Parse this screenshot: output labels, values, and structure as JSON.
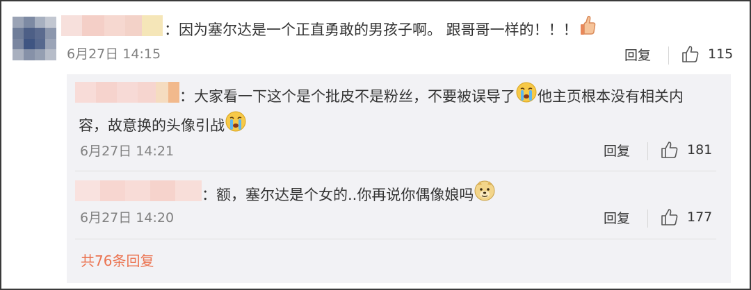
{
  "main_comment": {
    "text_part1": "：因为塞尔达是一个正直勇敢的男孩子啊。 跟哥哥一样的！！！",
    "time": "6月27日 14:15",
    "reply_label": "回复",
    "likes": "115",
    "emoji_icon": "thumbs-up-hand-icon"
  },
  "replies": [
    {
      "text_line1_a": "：大家看一下这个是个批皮不是粉丝，不要被误导了",
      "text_line1_b": "他主页根本没有相关内",
      "text_line2": "容，故意换的头像引战",
      "time": "6月27日 14:21",
      "reply_label": "回复",
      "likes": "181",
      "emoji_icon": "crying-face-icon"
    },
    {
      "text": "：额，塞尔达是个女的..你再说你偶像娘吗",
      "time": "6月27日 14:20",
      "reply_label": "回复",
      "likes": "177",
      "emoji_icon": "doge-icon"
    }
  ],
  "more_replies": "共76条回复",
  "colors": {
    "link_orange": "#eb7350",
    "time_gray": "#808080",
    "reply_bg": "#f2f2f5"
  }
}
